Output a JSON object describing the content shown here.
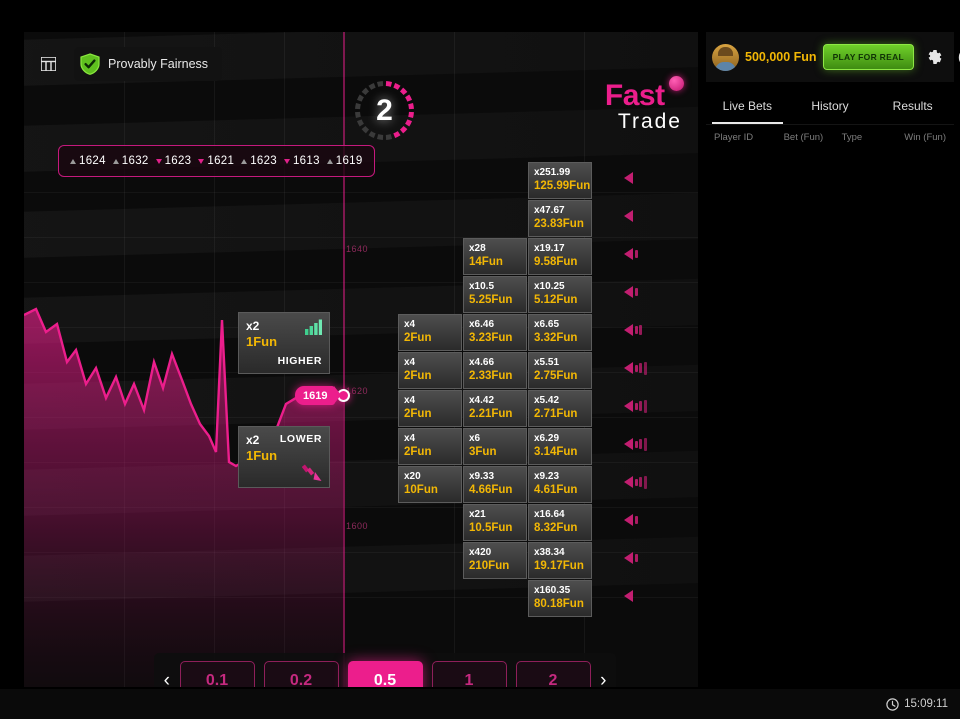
{
  "brand": {
    "name_primary": "Fast",
    "name_secondary": "Trade",
    "ball_icon": "pink-ball-icon"
  },
  "topbar": {
    "grid_icon": "grid-icon",
    "provably_fairness_label": "Provably Fairness",
    "shield_icon": "shield-check-icon"
  },
  "history": {
    "items": [
      {
        "value": "1624",
        "dir": "up"
      },
      {
        "value": "1632",
        "dir": "up"
      },
      {
        "value": "1623",
        "dir": "down"
      },
      {
        "value": "1621",
        "dir": "down"
      },
      {
        "value": "1623",
        "dir": "up"
      },
      {
        "value": "1613",
        "dir": "down"
      },
      {
        "value": "1619",
        "dir": "up"
      }
    ]
  },
  "timer": {
    "seconds": "2"
  },
  "chart": {
    "current_price": "1619",
    "axis_labels": [
      "1640",
      "1620",
      "1600"
    ],
    "series_color": "#ec1e8c"
  },
  "bet_cards": [
    {
      "id": "higher",
      "multiplier": "x2",
      "amount": "1Fun",
      "direction": "HIGHER",
      "icon": "bars-up-icon"
    },
    {
      "id": "lower",
      "multiplier": "x2",
      "amount": "1Fun",
      "direction": "LOWER",
      "icon": "arrow-down-icon"
    }
  ],
  "multiplier_grid": {
    "rows": [
      {
        "cells": [
          null,
          null,
          {
            "m": "x251.99",
            "a": "125.99Fun"
          }
        ],
        "volume": 1
      },
      {
        "cells": [
          null,
          null,
          {
            "m": "x47.67",
            "a": "23.83Fun"
          }
        ],
        "volume": 1
      },
      {
        "cells": [
          null,
          {
            "m": "x28",
            "a": "14Fun"
          },
          {
            "m": "x19.17",
            "a": "9.58Fun"
          }
        ],
        "volume": 2
      },
      {
        "cells": [
          null,
          {
            "m": "x10.5",
            "a": "5.25Fun"
          },
          {
            "m": "x10.25",
            "a": "5.12Fun"
          }
        ],
        "volume": 2
      },
      {
        "cells": [
          {
            "m": "x4",
            "a": "2Fun"
          },
          {
            "m": "x6.46",
            "a": "3.23Fun"
          },
          {
            "m": "x6.65",
            "a": "3.32Fun"
          }
        ],
        "volume": 3
      },
      {
        "cells": [
          {
            "m": "x4",
            "a": "2Fun"
          },
          {
            "m": "x4.66",
            "a": "2.33Fun"
          },
          {
            "m": "x5.51",
            "a": "2.75Fun"
          }
        ],
        "volume": 4
      },
      {
        "cells": [
          {
            "m": "x4",
            "a": "2Fun"
          },
          {
            "m": "x4.42",
            "a": "2.21Fun"
          },
          {
            "m": "x5.42",
            "a": "2.71Fun"
          }
        ],
        "volume": 4
      },
      {
        "cells": [
          {
            "m": "x4",
            "a": "2Fun"
          },
          {
            "m": "x6",
            "a": "3Fun"
          },
          {
            "m": "x6.29",
            "a": "3.14Fun"
          }
        ],
        "volume": 4
      },
      {
        "cells": [
          {
            "m": "x20",
            "a": "10Fun"
          },
          {
            "m": "x9.33",
            "a": "4.66Fun"
          },
          {
            "m": "x9.23",
            "a": "4.61Fun"
          }
        ],
        "volume": 4
      },
      {
        "cells": [
          null,
          {
            "m": "x21",
            "a": "10.5Fun"
          },
          {
            "m": "x16.64",
            "a": "8.32Fun"
          }
        ],
        "volume": 2
      },
      {
        "cells": [
          null,
          {
            "m": "x420",
            "a": "210Fun"
          },
          {
            "m": "x38.34",
            "a": "19.17Fun"
          }
        ],
        "volume": 2
      },
      {
        "cells": [
          null,
          null,
          {
            "m": "x160.35",
            "a": "80.18Fun"
          }
        ],
        "volume": 1
      }
    ]
  },
  "amount_selector": {
    "prev_icon": "chevron-left-icon",
    "next_icon": "chevron-right-icon",
    "options": [
      "0.1",
      "0.2",
      "0.5",
      "1",
      "2"
    ],
    "selected": "0.5"
  },
  "account": {
    "avatar_icon": "user-avatar",
    "balance": "500,000 Fun",
    "play_for_real_label": "PLAY FOR REAL",
    "settings_icon": "gear-icon",
    "info_icon": "info-icon"
  },
  "panel": {
    "tabs": [
      "Live Bets",
      "History",
      "Results"
    ],
    "active_tab": "Live Bets",
    "columns": [
      "Player ID",
      "Bet (Fun)",
      "Type",
      "Win (Fun)"
    ]
  },
  "status": {
    "clock_icon": "clock-icon",
    "time": "15:09:11"
  }
}
